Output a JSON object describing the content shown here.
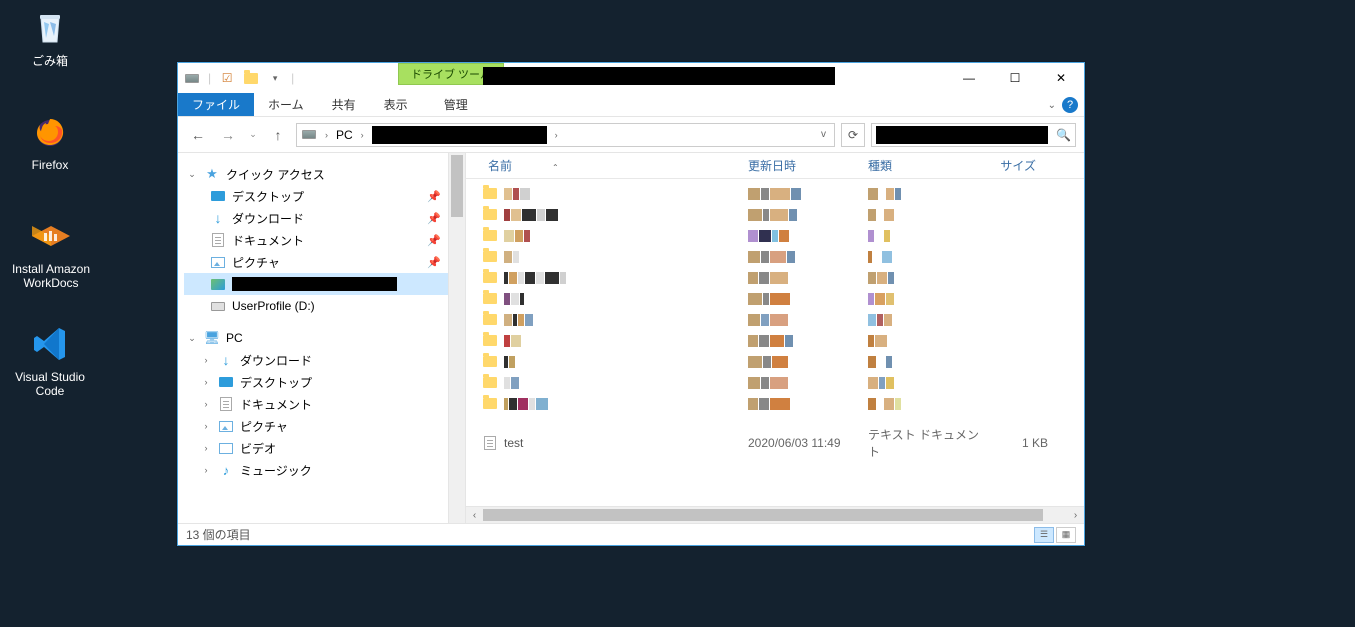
{
  "desktop": {
    "recycle_bin": "ごみ箱",
    "firefox": "Firefox",
    "workdocs_l1": "Install Amazon",
    "workdocs_l2": "WorkDocs",
    "vscode": "Visual Studio Code"
  },
  "explorer": {
    "tools_tab": "ドライブ ツール",
    "manage_tab": "管理",
    "ribbon": {
      "file": "ファイル",
      "home": "ホーム",
      "share": "共有",
      "view": "表示"
    },
    "breadcrumb": {
      "pc": "PC"
    },
    "addr_dropdown": "v",
    "tree": {
      "quick_access": "クイック アクセス",
      "desktop": "デスクトップ",
      "downloads": "ダウンロード",
      "documents": "ドキュメント",
      "pictures": "ピクチャ",
      "userprofile": "UserProfile (D:)",
      "pc": "PC",
      "pc_downloads": "ダウンロード",
      "pc_desktop": "デスクトップ",
      "pc_documents": "ドキュメント",
      "pc_pictures": "ピクチャ",
      "pc_videos": "ビデオ",
      "pc_music": "ミュージック"
    },
    "columns": {
      "name": "名前",
      "date": "更新日時",
      "type": "種類",
      "size": "サイズ"
    },
    "rows": {
      "visible_row": {
        "name": "test",
        "date": "2020/06/03 11:49",
        "type": "テキスト ドキュメント",
        "size": "1 KB"
      }
    },
    "status": "13 個の項目"
  }
}
